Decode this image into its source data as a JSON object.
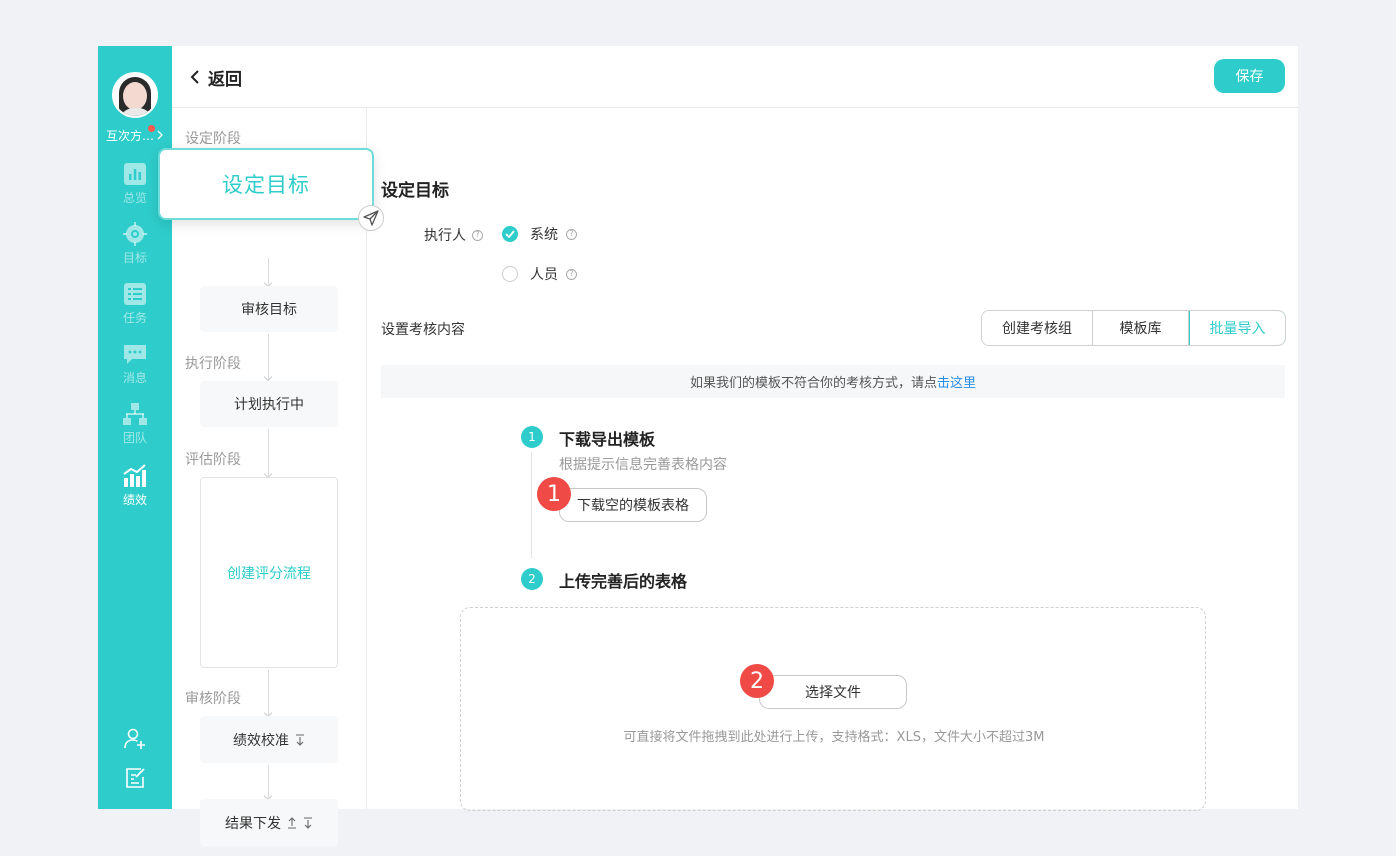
{
  "sidebar": {
    "username": "互次方…",
    "items": [
      {
        "label": "总览",
        "icon": "bar-chart-icon"
      },
      {
        "label": "目标",
        "icon": "target-icon"
      },
      {
        "label": "任务",
        "icon": "task-list-icon"
      },
      {
        "label": "消息",
        "icon": "message-icon"
      },
      {
        "label": "团队",
        "icon": "team-icon"
      },
      {
        "label": "绩效",
        "icon": "performance-icon"
      }
    ],
    "bottom_icons": [
      "add-user-icon",
      "edit-doc-icon"
    ]
  },
  "header": {
    "back_label": "返回",
    "save_label": "保存"
  },
  "stages": {
    "set_stage": "设定阶段",
    "set_goal_popup": "设定目标",
    "review_goal": "审核目标",
    "exec_stage": "执行阶段",
    "plan_exec": "计划执行中",
    "eval_stage": "评估阶段",
    "create_flow": "创建评分流程",
    "audit_stage": "审核阶段",
    "calibration": "绩效校准",
    "result_issue": "结果下发"
  },
  "main": {
    "title": "设定目标",
    "executor_label": "执行人",
    "option_system": "系统",
    "option_person": "人员",
    "assess_label": "设置考核内容",
    "seg_buttons": [
      "创建考核组",
      "模板库",
      "批量导入"
    ],
    "tip_text": "如果我们的模板不符合你的考核方式，请点",
    "tip_link": "击这里",
    "step1_num": "1",
    "step1_title": "下载导出模板",
    "step1_desc": "根据提示信息完善表格内容",
    "step1_button": "下载空的模板表格",
    "badge1": "1",
    "step2_num": "2",
    "step2_title": "上传完善后的表格",
    "step2_button": "选择文件",
    "badge2": "2",
    "drop_hint": "可直接将文件拖拽到此处进行上传，支持格式：XLS，文件大小不超过3M"
  },
  "colors": {
    "accent": "#2ecdcb",
    "link": "#2a8ee8",
    "badge": "#f04a46"
  }
}
